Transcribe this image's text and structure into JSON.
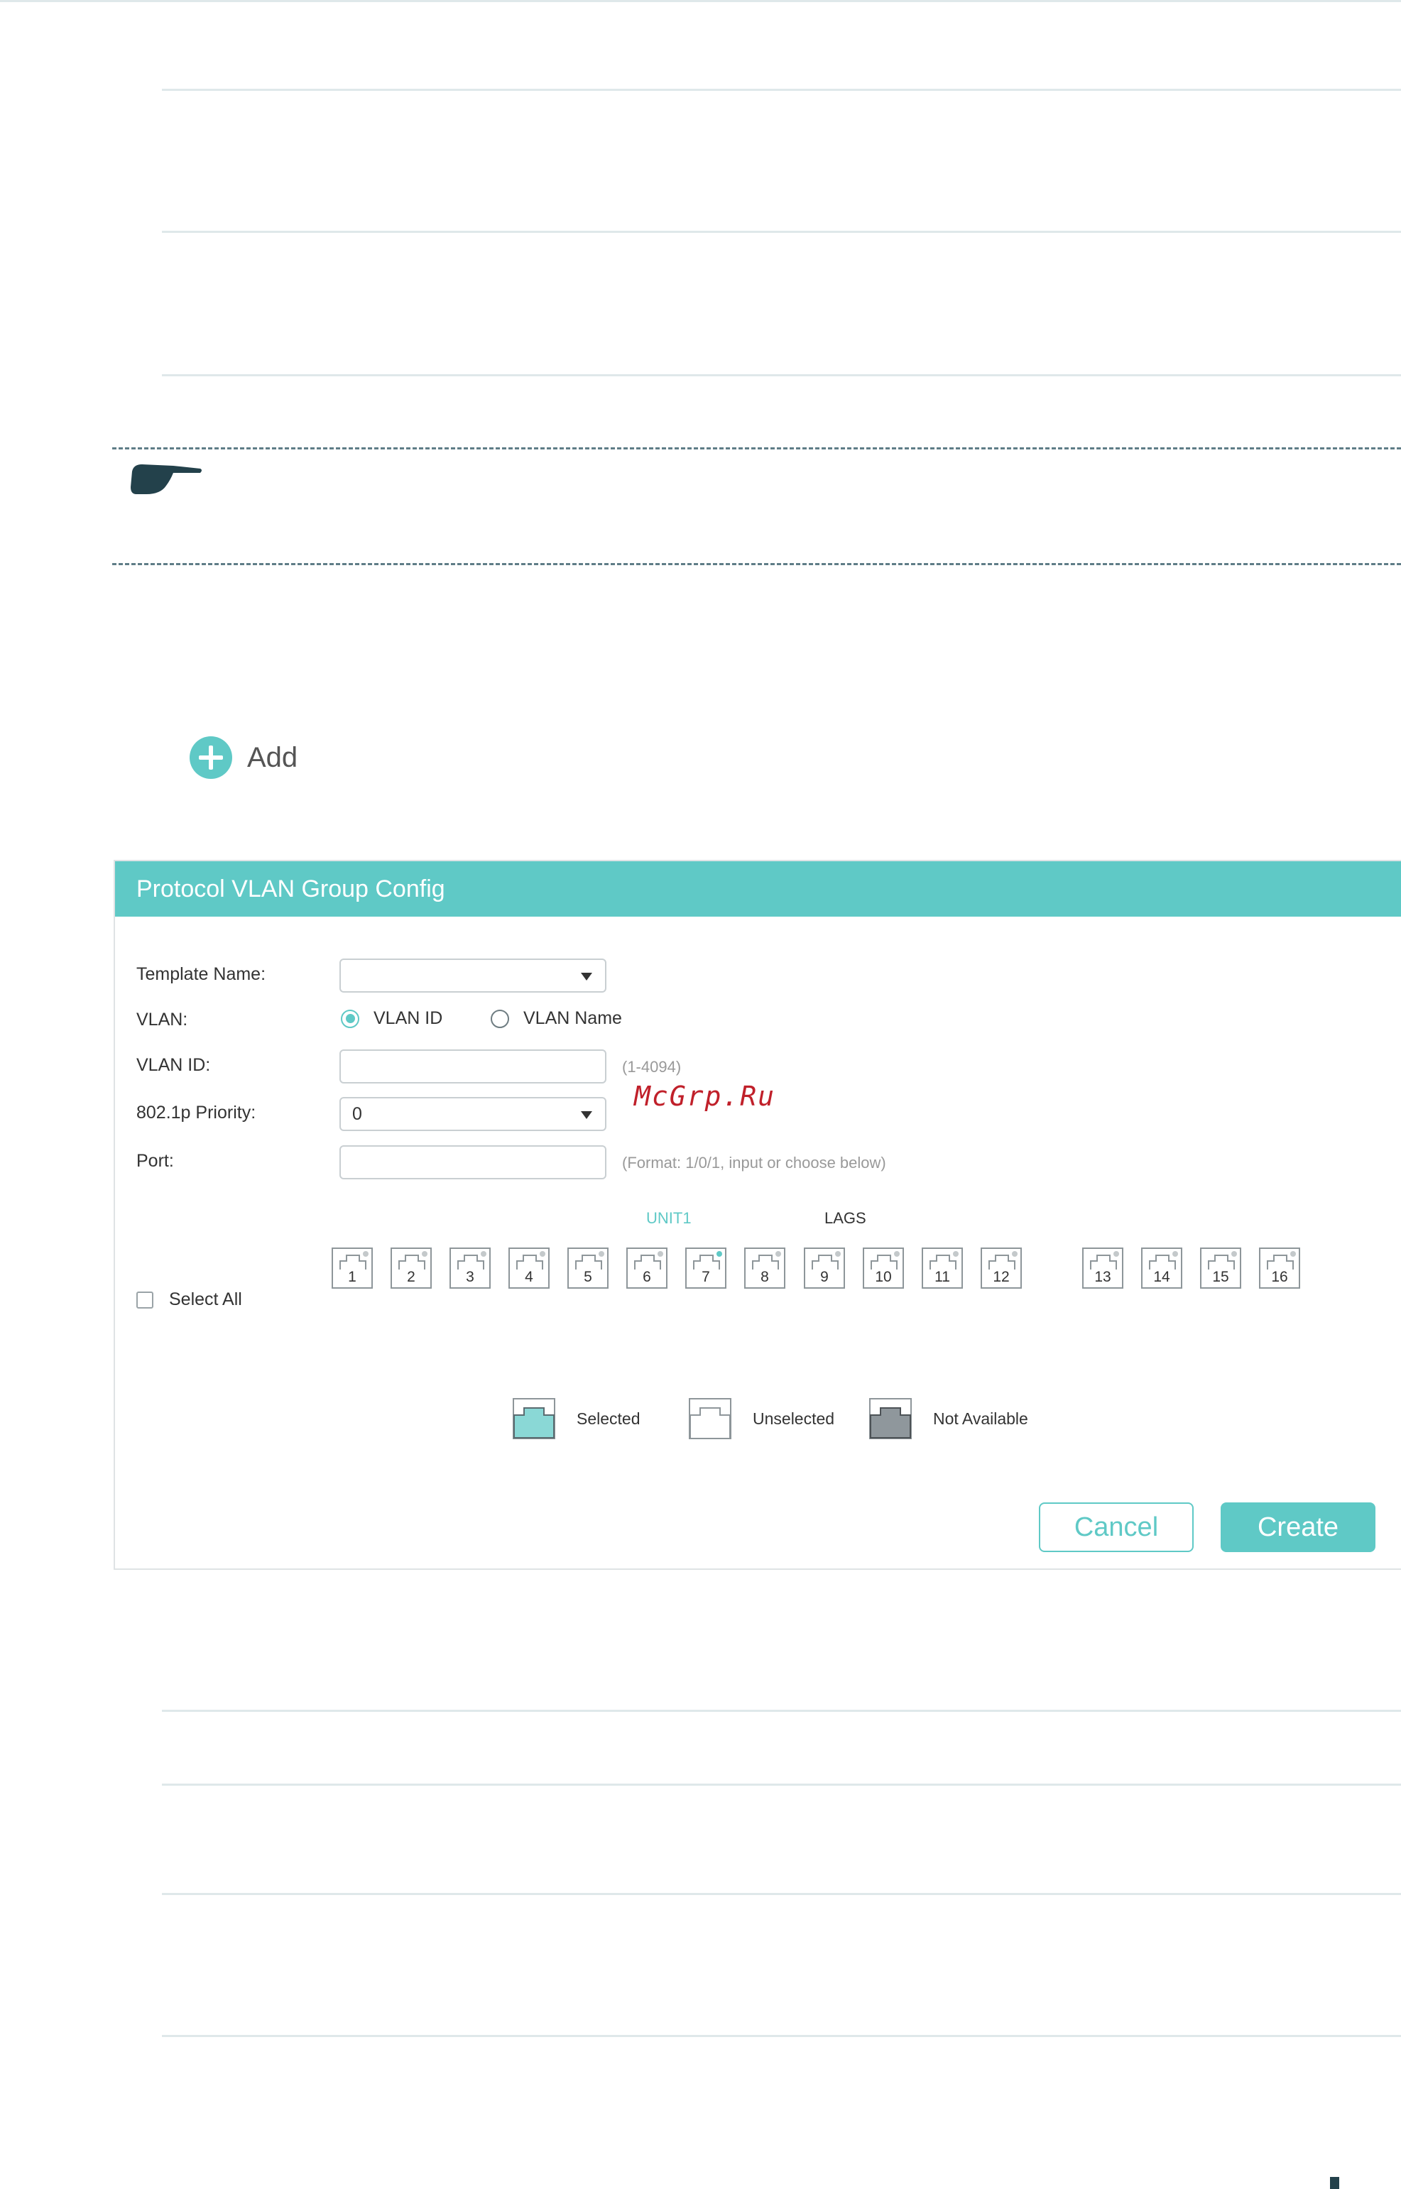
{
  "add_button": {
    "label": "Add"
  },
  "panel": {
    "title": "Protocol VLAN Group Config",
    "template_name": {
      "label": "Template Name:",
      "value": ""
    },
    "vlan": {
      "label": "VLAN:",
      "options": [
        "VLAN ID",
        "VLAN Name"
      ],
      "selected": "VLAN ID"
    },
    "vlan_id": {
      "label": "VLAN ID:",
      "value": "",
      "hint": "(1-4094)"
    },
    "priority": {
      "label": "802.1p Priority:",
      "value": "0"
    },
    "port": {
      "label": "Port:",
      "value": "",
      "hint": "(Format: 1/0/1, input or choose below)"
    },
    "unit_label": "UNIT1",
    "lags_label": "LAGS",
    "select_all": "Select All",
    "ports": [
      {
        "label": "1",
        "active": false
      },
      {
        "label": "2",
        "active": false
      },
      {
        "label": "3",
        "active": false
      },
      {
        "label": "4",
        "active": false
      },
      {
        "label": "5",
        "active": false
      },
      {
        "label": "6",
        "active": false
      },
      {
        "label": "7",
        "active": true
      },
      {
        "label": "8",
        "active": false
      },
      {
        "label": "9",
        "active": false
      },
      {
        "label": "10",
        "active": false
      },
      {
        "label": "11",
        "active": false
      },
      {
        "label": "12",
        "active": false
      },
      {
        "label": "13",
        "active": false
      },
      {
        "label": "14",
        "active": false
      },
      {
        "label": "15",
        "active": false
      },
      {
        "label": "16",
        "active": false
      }
    ],
    "legend": {
      "selected": "Selected",
      "unselected": "Unselected",
      "not_available": "Not Available"
    },
    "cancel_label": "Cancel",
    "create_label": "Create"
  },
  "watermark": "McGrp.Ru",
  "colors": {
    "accent": "#5fc9c6",
    "rule": "#dfe8ea",
    "not_available": "#8f979c",
    "watermark": "#c0202a"
  }
}
